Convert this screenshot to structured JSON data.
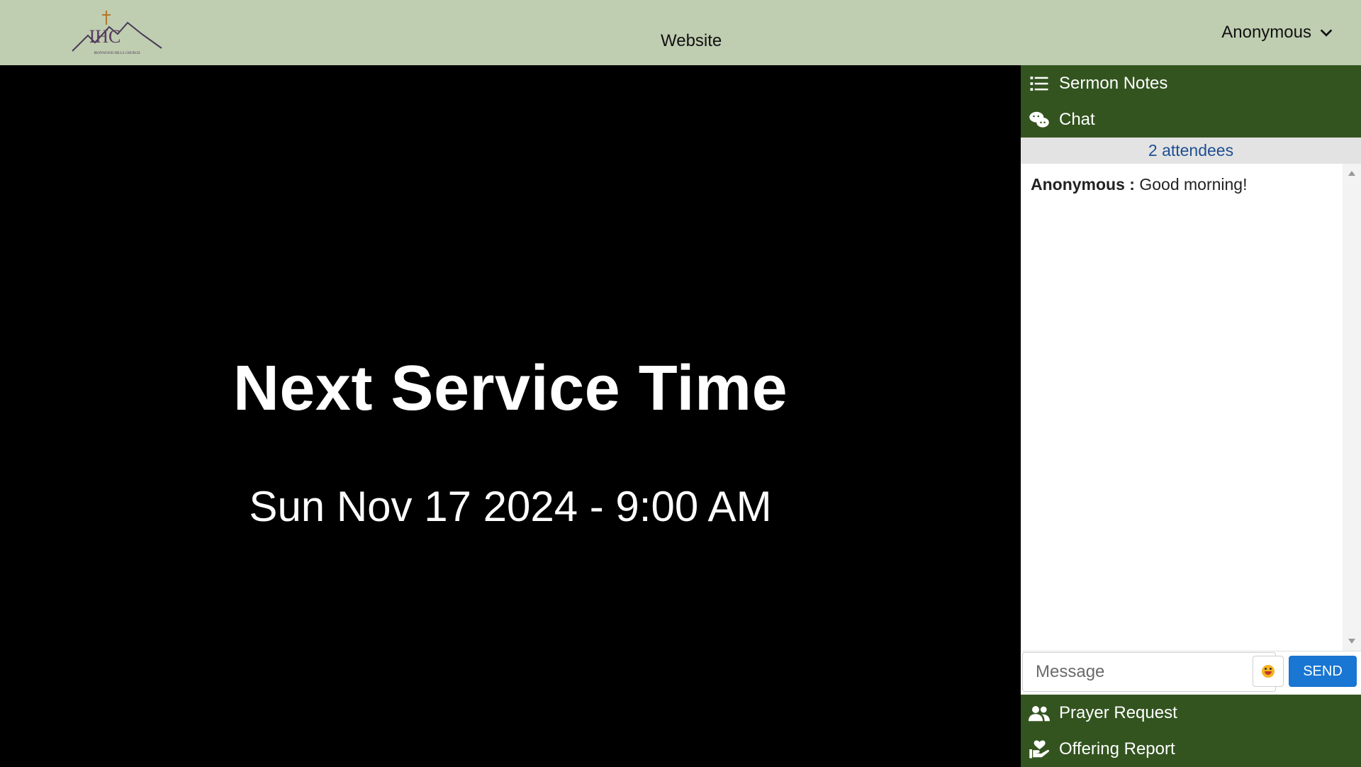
{
  "header": {
    "logo_icon": "ironwood-hills-church-logo",
    "logo_text": "IHC",
    "logo_subtext": "IRONWOOD HILLS CHURCH",
    "nav_website": "Website",
    "user": "Anonymous"
  },
  "video": {
    "title": "Next Service Time",
    "datetime": "Sun Nov 17 2024 - 9:00 AM"
  },
  "sidebar": {
    "tabs": [
      {
        "label": "Sermon Notes",
        "icon": "list-icon"
      },
      {
        "label": "Chat",
        "icon": "chat-bubbles-icon"
      }
    ],
    "attendees": "2 attendees",
    "messages": [
      {
        "author": "Anonymous :",
        "text": "Good morning!"
      }
    ],
    "composer": {
      "placeholder": "Message",
      "send_label": "SEND"
    },
    "bottom_tabs": [
      {
        "label": "Prayer Request",
        "icon": "people-icon"
      },
      {
        "label": "Offering Report",
        "icon": "hand-heart-icon"
      }
    ]
  },
  "colors": {
    "header_bg": "#bfcdb1",
    "tab_bg": "#33541f",
    "send_button": "#1976d2",
    "attendees_text": "#1f4f91"
  }
}
